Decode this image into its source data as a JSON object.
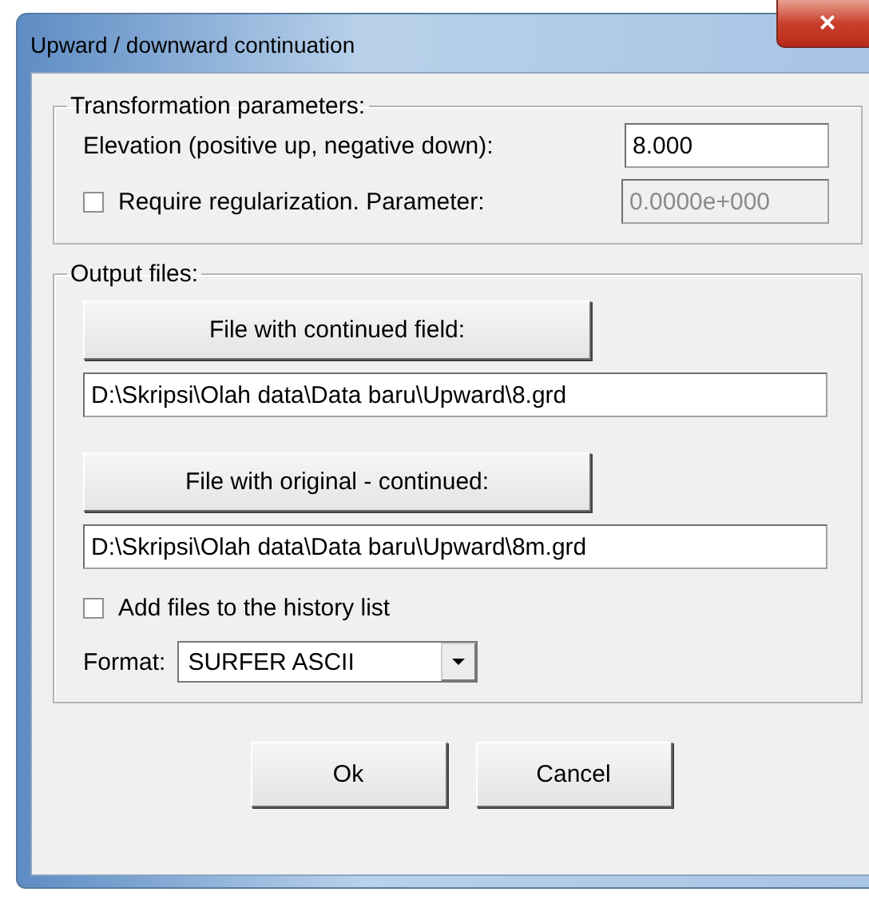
{
  "window": {
    "title": "Upward / downward  continuation",
    "close": "×"
  },
  "transformation": {
    "legend": "Transformation parameters:",
    "elevation": {
      "label": "Elevation (positive up, negative down):",
      "value": "8.000",
      "disabled": false
    },
    "regularization": {
      "label": "Require regularization. Parameter:",
      "checked": false
    },
    "parameter": {
      "value": "0.0000e+000",
      "disabled": true
    }
  },
  "output": {
    "legend": "Output files:",
    "files": [
      {
        "button": "File with continued field:",
        "path": "D:\\Skripsi\\Olah data\\Data baru\\Upward\\8.grd"
      },
      {
        "button": "File with original - continued:",
        "path": "D:\\Skripsi\\Olah data\\Data baru\\Upward\\8m.grd"
      }
    ],
    "history": {
      "label": "Add files to the history list",
      "checked": false
    },
    "format": {
      "label": "Format:",
      "value": "SURFER ASCII"
    }
  },
  "buttons": [
    "Ok",
    "Cancel"
  ]
}
